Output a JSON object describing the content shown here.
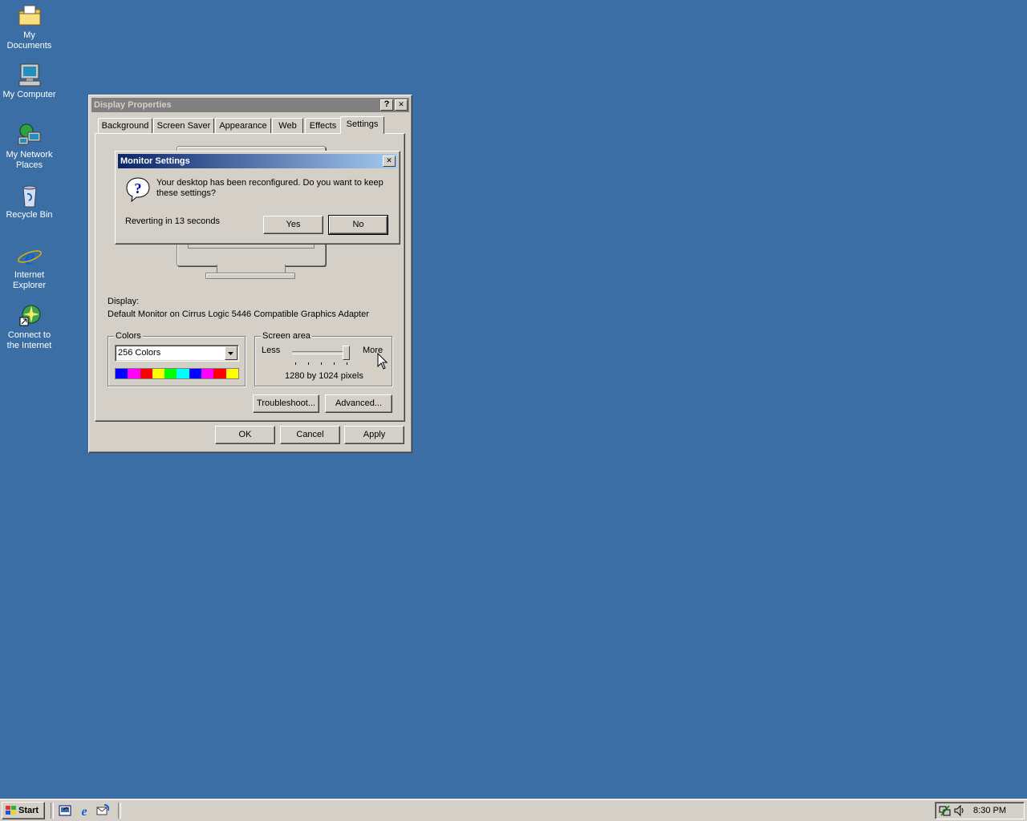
{
  "desktop": {
    "icons": [
      {
        "label": "My Documents"
      },
      {
        "label": "My Computer"
      },
      {
        "label": "My Network\nPlaces"
      },
      {
        "label": "Recycle Bin"
      },
      {
        "label": "Internet\nExplorer"
      },
      {
        "label": "Connect to\nthe Internet"
      }
    ]
  },
  "display_properties": {
    "title": "Display Properties",
    "help_glyph": "?",
    "close_glyph": "✕",
    "tabs": [
      {
        "label": "Background"
      },
      {
        "label": "Screen Saver"
      },
      {
        "label": "Appearance"
      },
      {
        "label": "Web"
      },
      {
        "label": "Effects"
      },
      {
        "label": "Settings",
        "selected": true
      }
    ],
    "display_label": "Display:",
    "display_value": "Default Monitor on Cirrus Logic 5446 Compatible Graphics Adapter",
    "colors": {
      "legend": "Colors",
      "selected": "256 Colors",
      "palette": [
        "#0000ff",
        "#ff00ff",
        "#ff0000",
        "#ffff00",
        "#00ff00",
        "#00ffff",
        "#0000ff",
        "#ff00ff",
        "#ff0000",
        "#ffff00"
      ]
    },
    "screen_area": {
      "legend": "Screen area",
      "less_label": "Less",
      "more_label": "More",
      "resolution_text": "1280 by 1024 pixels",
      "slider_position": 1.0
    },
    "buttons": {
      "troubleshoot": "Troubleshoot...",
      "advanced": "Advanced...",
      "ok": "OK",
      "cancel": "Cancel",
      "apply": "Apply"
    }
  },
  "monitor_settings": {
    "title": "Monitor Settings",
    "close_glyph": "✕",
    "message": "Your desktop has been reconfigured.  Do you want to keep these settings?",
    "countdown": "Reverting in 13 seconds",
    "yes_label": "Yes",
    "no_label": "No",
    "icon": "question-icon"
  },
  "taskbar": {
    "start_label": "Start",
    "clock": "8:30 PM",
    "quick_launch": [
      "show-desktop-icon",
      "internet-explorer-icon",
      "outlook-express-icon"
    ],
    "tray": [
      "network-icon",
      "volume-icon"
    ]
  },
  "colors": {
    "desktop": "#3a6ea5",
    "face": "#d4d0c8",
    "active_title": "#0a246a",
    "inactive_title": "#808080"
  }
}
